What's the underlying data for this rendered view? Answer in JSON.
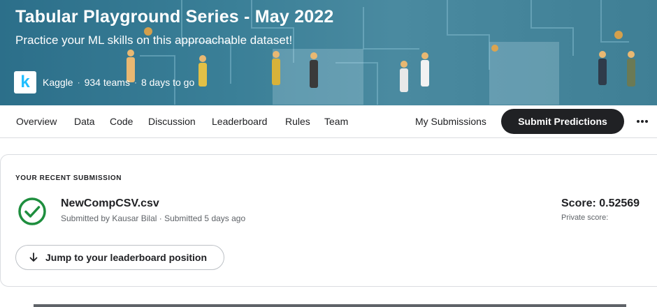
{
  "header": {
    "title": "Tabular Playground Series - May 2022",
    "subtitle": "Practice your ML skills on this approachable dataset!",
    "logo_letter": "k",
    "host": "Kaggle",
    "teams": "934 teams",
    "deadline": "8 days to go",
    "separator": "·"
  },
  "tabs": [
    {
      "label": "Overview"
    },
    {
      "label": "Data"
    },
    {
      "label": "Code"
    },
    {
      "label": "Discussion"
    },
    {
      "label": "Leaderboard"
    },
    {
      "label": "Rules"
    },
    {
      "label": "Team"
    }
  ],
  "actions": {
    "my_submissions": "My Submissions",
    "submit_predictions": "Submit Predictions"
  },
  "submission": {
    "section_label": "YOUR RECENT SUBMISSION",
    "filename": "NewCompCSV.csv",
    "meta": "Submitted by Kausar Bilal · Submitted 5 days ago",
    "score": "Score: 0.52569",
    "private_score": "Private score:",
    "jump_label": "Jump to your leaderboard position"
  },
  "colors": {
    "success": "#1e8e3e",
    "brand": "#20beff",
    "button_dark": "#202124"
  }
}
